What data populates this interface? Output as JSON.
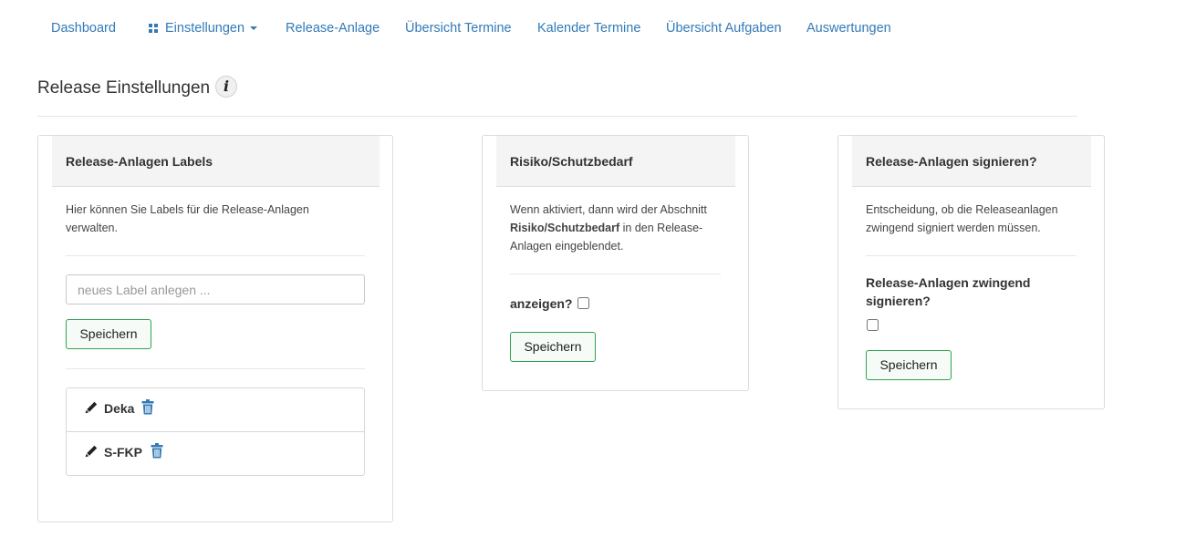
{
  "nav": {
    "items": [
      {
        "label": "Dashboard"
      },
      {
        "label": "Einstellungen",
        "has_dropdown": true,
        "icon": "grid-icon"
      },
      {
        "label": "Release-Anlage"
      },
      {
        "label": "Übersicht Termine"
      },
      {
        "label": "Kalender Termine"
      },
      {
        "label": "Übersicht Aufgaben"
      },
      {
        "label": "Auswertungen"
      }
    ]
  },
  "page": {
    "title": "Release Einstellungen",
    "info_icon_glyph": "i"
  },
  "panels": {
    "labels": {
      "heading": "Release-Anlagen Labels",
      "description": "Hier können Sie Labels für die Release-Anlagen verwalten.",
      "input_placeholder": "neues Label anlegen ...",
      "input_value": "",
      "save_label": "Speichern",
      "items": [
        {
          "name": "Deka"
        },
        {
          "name": "S-FKP"
        }
      ]
    },
    "risk": {
      "heading": "Risiko/Schutzbedarf",
      "description_pre": "Wenn aktiviert, dann wird der Abschnitt ",
      "description_bold": "Risiko/Schutzbedarf",
      "description_post": " in den Release-Anlagen eingeblendet.",
      "checkbox_label": "anzeigen?",
      "checked": false,
      "save_label": "Speichern"
    },
    "sign": {
      "heading": "Release-Anlagen signieren?",
      "description": "Entscheidung, ob die Releaseanlagen zwingend signiert werden müssen.",
      "checkbox_label": "Release-Anlagen zwingend signieren?",
      "checked": false,
      "save_label": "Speichern"
    }
  },
  "colors": {
    "link": "#337ab7",
    "button_border": "#2ea44f",
    "trash_icon": "#337ab7",
    "panel_heading_bg": "#f4f4f5"
  }
}
